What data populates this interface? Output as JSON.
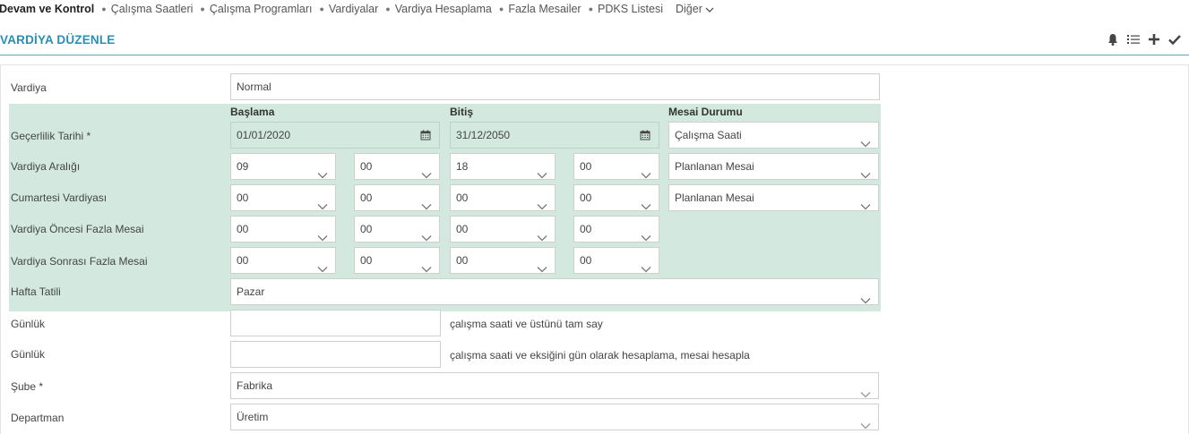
{
  "nav": {
    "title": "Devam ve Kontrol",
    "items": [
      "Çalışma Saatleri",
      "Çalışma Programları",
      "Vardiyalar",
      "Vardiya Hesaplama",
      "Fazla Mesailer",
      "PDKS Listesi"
    ],
    "more": "Diğer"
  },
  "header": {
    "title": "VARDİYA DÜZENLE",
    "icons": [
      "bell-icon",
      "list-icon",
      "plus-icon",
      "check-icon"
    ]
  },
  "form": {
    "vardiya_label": "Vardiya",
    "vardiya_value": "Normal",
    "col_baslama": "Başlama",
    "col_bitis": "Bitiş",
    "col_mesai": "Mesai Durumu",
    "gecerlilik_label": "Geçerlilik Tarihi *",
    "gecerlilik_start": "01/01/2020",
    "gecerlilik_end": "31/12/2050",
    "gecerlilik_mesai": "Çalışma Saati",
    "aralik_label": "Vardiya Aralığı",
    "aralik": [
      "09",
      "00",
      "18",
      "00"
    ],
    "aralik_mesai": "Planlanan Mesai",
    "cumartesi_label": "Cumartesi Vardiyası",
    "cumartesi": [
      "00",
      "00",
      "00",
      "00"
    ],
    "cumartesi_mesai": "Planlanan Mesai",
    "oncesi_label": "Vardiya Öncesi Fazla Mesai",
    "oncesi": [
      "00",
      "00",
      "00",
      "00"
    ],
    "sonrasi_label": "Vardiya Sonrası Fazla Mesai",
    "sonrasi": [
      "00",
      "00",
      "00",
      "00"
    ],
    "hafta_label": "Hafta Tatili",
    "hafta_value": "Pazar",
    "gunluk1_label": "Günlük",
    "gunluk1_hint": "çalışma saati ve üstünü tam say",
    "gunluk2_label": "Günlük",
    "gunluk2_hint": "çalışma saati ve eksiğini gün olarak hesaplama, mesai hesapla",
    "sube_label": "Şube *",
    "sube_value": "Fabrika",
    "departman_label": "Departman",
    "departman_value": "Üretim"
  },
  "colors": {
    "accent": "#2a8fb0",
    "section_bg": "#d3e9df"
  }
}
